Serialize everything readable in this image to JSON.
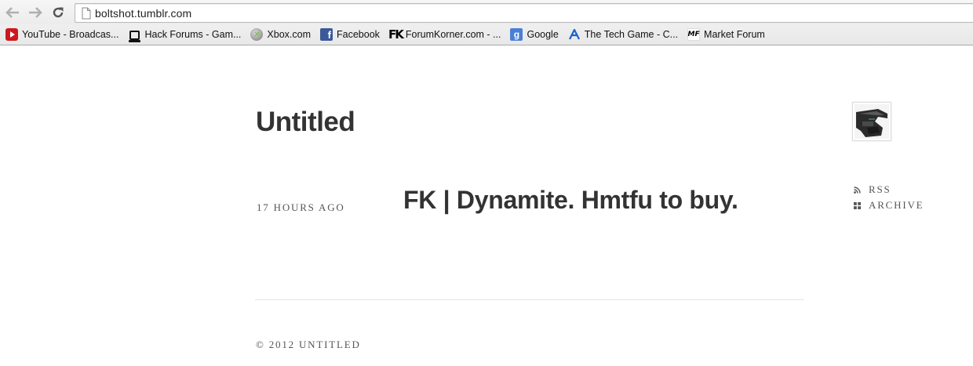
{
  "browser": {
    "url": "boltshot.tumblr.com",
    "bookmarks": [
      {
        "label": "YouTube - Broadcas...",
        "icon": "youtube-icon"
      },
      {
        "label": "Hack Forums - Gam...",
        "icon": "hackforums-icon"
      },
      {
        "label": "Xbox.com",
        "icon": "xbox-icon"
      },
      {
        "label": "Facebook",
        "icon": "facebook-icon"
      },
      {
        "label": "ForumKorner.com - ...",
        "icon": "forumkorner-icon"
      },
      {
        "label": "Google",
        "icon": "google-icon"
      },
      {
        "label": "The Tech Game - C...",
        "icon": "techgame-icon"
      },
      {
        "label": "Market Forum",
        "icon": "marketforum-icon"
      }
    ]
  },
  "blog": {
    "title": "Untitled",
    "post": {
      "date": "17 HOURS AGO",
      "title": "FK | Dynamite. Hmtfu to buy."
    },
    "links": {
      "rss": "RSS",
      "archive": "ARCHIVE"
    },
    "footer": "© 2012 UNTITLED"
  },
  "colors": {
    "text": "#333333",
    "meta": "#555555",
    "divider": "#e4e4e4",
    "youtube": "#cc181e",
    "facebook": "#3b5998"
  }
}
